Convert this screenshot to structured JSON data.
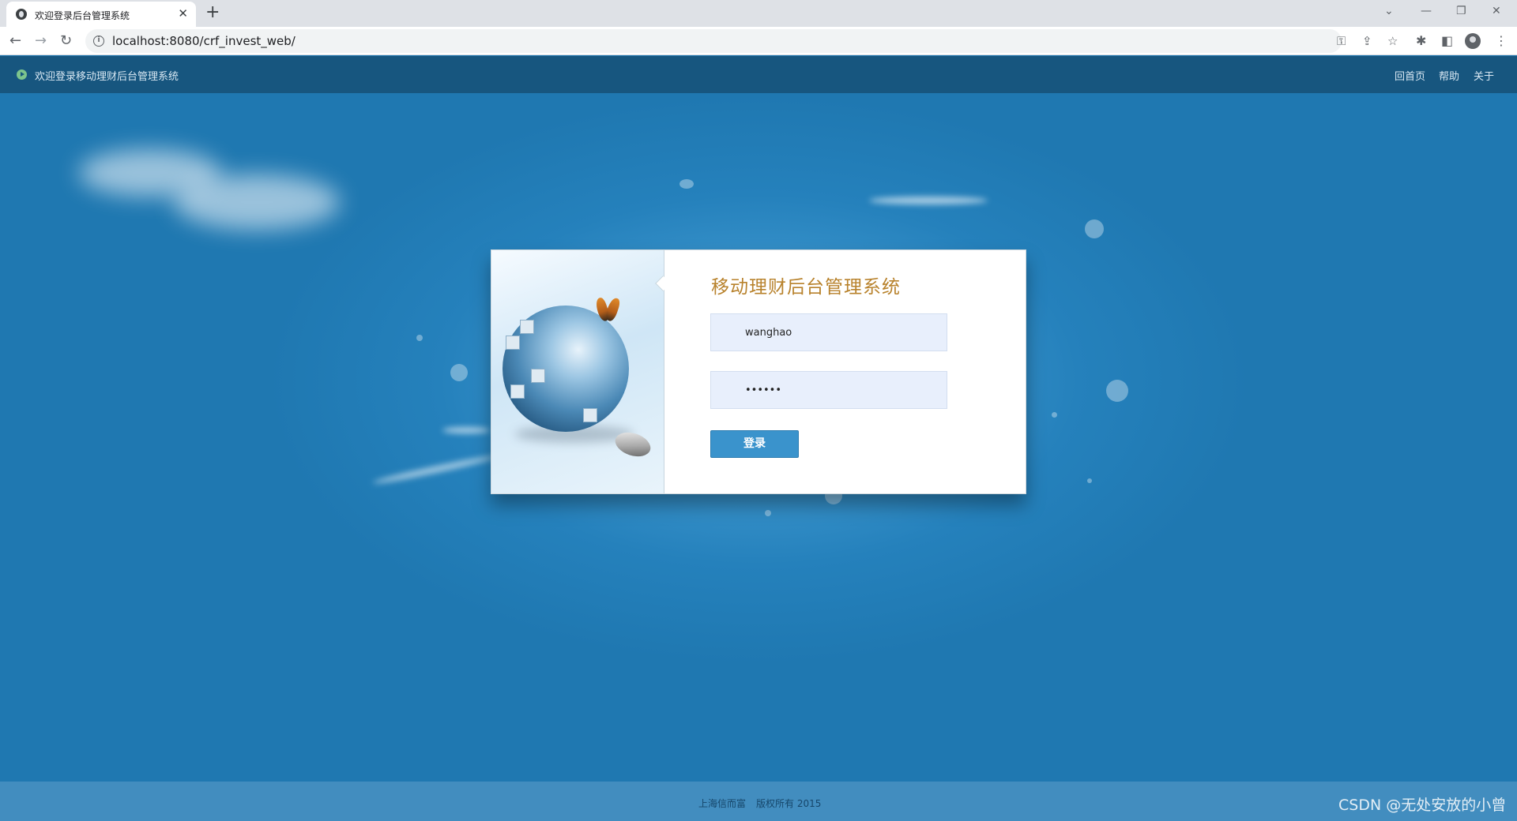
{
  "browser": {
    "tab_title": "欢迎登录后台管理系统",
    "tab_close": "✕",
    "new_tab": "+",
    "url": "localhost:8080/crf_invest_web/"
  },
  "topbar": {
    "title": "欢迎登录移动理财后台管理系统",
    "nav": [
      "回首页",
      "帮助",
      "关于"
    ]
  },
  "login": {
    "title": "移动理财后台管理系统",
    "username_value": "wanghao",
    "password_value": "••••••",
    "submit_label": "登录"
  },
  "footer": {
    "company": "上海信而富",
    "copyright": "版权所有 2015"
  },
  "watermark": "CSDN @无处安放的小曾"
}
